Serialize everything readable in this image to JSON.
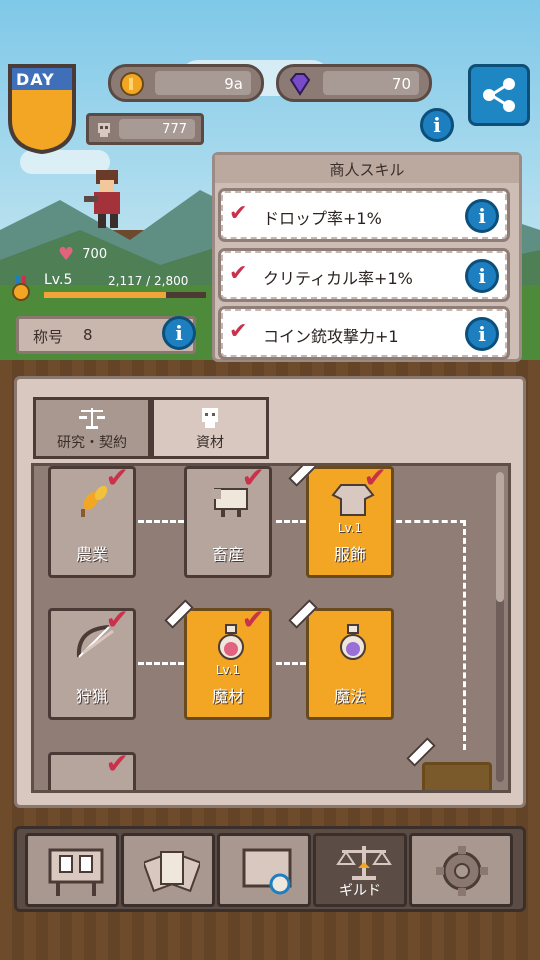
{
  "header": {
    "day_label": "DAY",
    "coins": "9a",
    "gems": "70",
    "population": "777"
  },
  "player": {
    "hp": "700",
    "level": "Lv.5",
    "xp_text": "2,117 / 2,800",
    "xp_fraction": 0.756,
    "title_label": "称号",
    "title_value": "8"
  },
  "skills": {
    "heading": "商人スキル",
    "items": [
      {
        "label": "ドロップ率+1%"
      },
      {
        "label": "クリティカル率+1%"
      },
      {
        "label": "コイン銃攻撃力+1"
      }
    ]
  },
  "tabs": [
    {
      "label": "研究・契約"
    },
    {
      "label": "資材"
    }
  ],
  "tree": {
    "nodes": [
      {
        "label": "農業",
        "lv": ""
      },
      {
        "label": "畜産",
        "lv": ""
      },
      {
        "label": "服飾",
        "lv": "Lv.1"
      },
      {
        "label": "狩猟",
        "lv": ""
      },
      {
        "label": "魔材",
        "lv": "Lv.1"
      },
      {
        "label": "魔法",
        "lv": ""
      }
    ]
  },
  "nav": {
    "guild_label": "ギルド"
  },
  "colors": {
    "accent": "#f2a623",
    "info_blue": "#1e7fc0",
    "check": "#c9324a"
  }
}
